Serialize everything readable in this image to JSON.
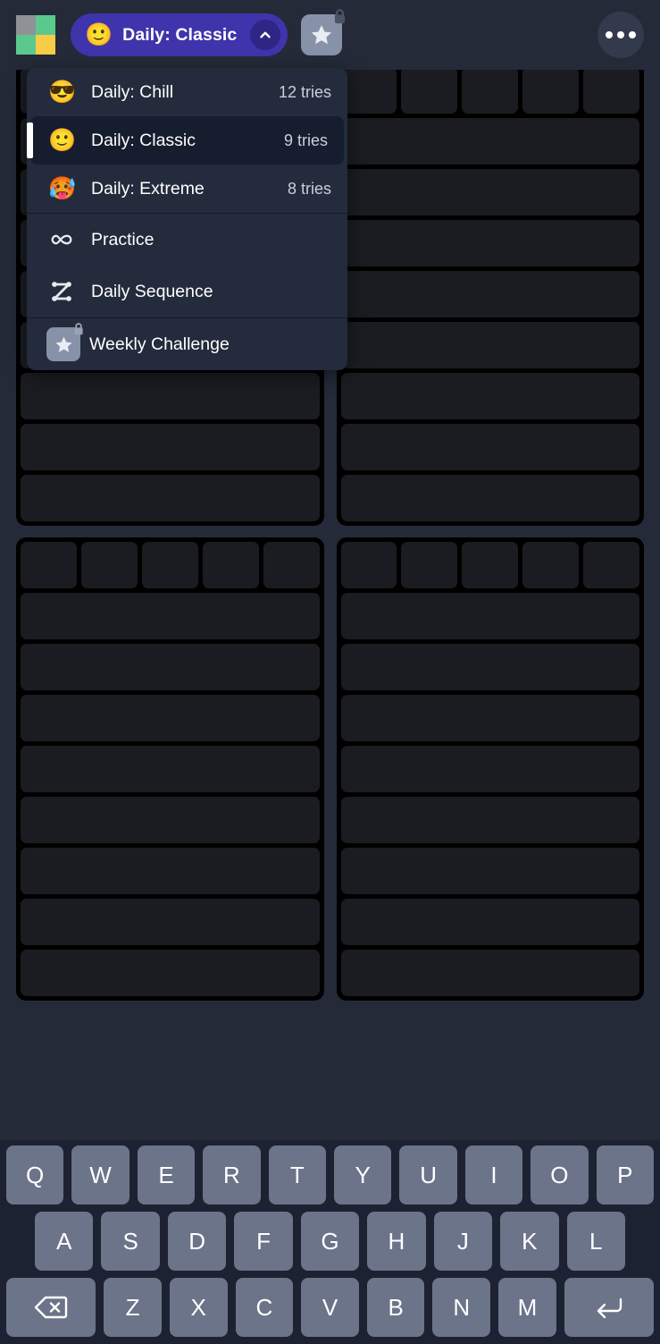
{
  "app": {
    "background_color": "#242a38",
    "accent_color": "#3f34ab",
    "logo": {
      "name": "app-logo",
      "tiles": [
        "#8e9296",
        "#5bc98d",
        "#5bc98d",
        "#f8cc46"
      ]
    }
  },
  "topbar": {
    "mode_pill": {
      "emoji": "🙂",
      "label": "Daily: Classic",
      "caret": "chevron-up-icon"
    },
    "weekly_button": {
      "icon": "star-icon",
      "locked": true
    },
    "more_button": {
      "icon": "more-horizontal-icon"
    }
  },
  "menu": {
    "modes": [
      {
        "emoji": "😎",
        "label": "Daily: Chill",
        "tries": "12 tries",
        "selected": false
      },
      {
        "emoji": "🙂",
        "label": "Daily: Classic",
        "tries": "9 tries",
        "selected": true
      },
      {
        "emoji": "🥵",
        "label": "Daily: Extreme",
        "tries": "8 tries",
        "selected": false
      }
    ],
    "extras": [
      {
        "icon": "infinity-icon",
        "label": "Practice"
      },
      {
        "icon": "zigzag-z-icon",
        "label": "Daily Sequence"
      }
    ],
    "locked": [
      {
        "icon": "star-icon",
        "label": "Weekly Challenge",
        "locked": true
      }
    ]
  },
  "boards": {
    "columns": 5,
    "cell_color": "#1a1c21",
    "frame_color": "#000000",
    "grids": [
      {
        "name": "board-top-left",
        "guess_rows": 9,
        "letters_row": 5
      },
      {
        "name": "board-top-right",
        "guess_rows": 9,
        "letters_row": 5
      },
      {
        "name": "board-bottom-left",
        "guess_rows": 9,
        "letters_row": 5
      },
      {
        "name": "board-bottom-right",
        "guess_rows": 9,
        "letters_row": 5
      }
    ]
  },
  "keyboard": {
    "row1": [
      "Q",
      "W",
      "E",
      "R",
      "T",
      "Y",
      "U",
      "I",
      "O",
      "P"
    ],
    "row2": [
      "A",
      "S",
      "D",
      "F",
      "G",
      "H",
      "J",
      "K",
      "L"
    ],
    "row3_letters": [
      "Z",
      "X",
      "C",
      "V",
      "B",
      "N",
      "M"
    ],
    "backspace": "backspace-icon",
    "enter": "enter-icon"
  }
}
